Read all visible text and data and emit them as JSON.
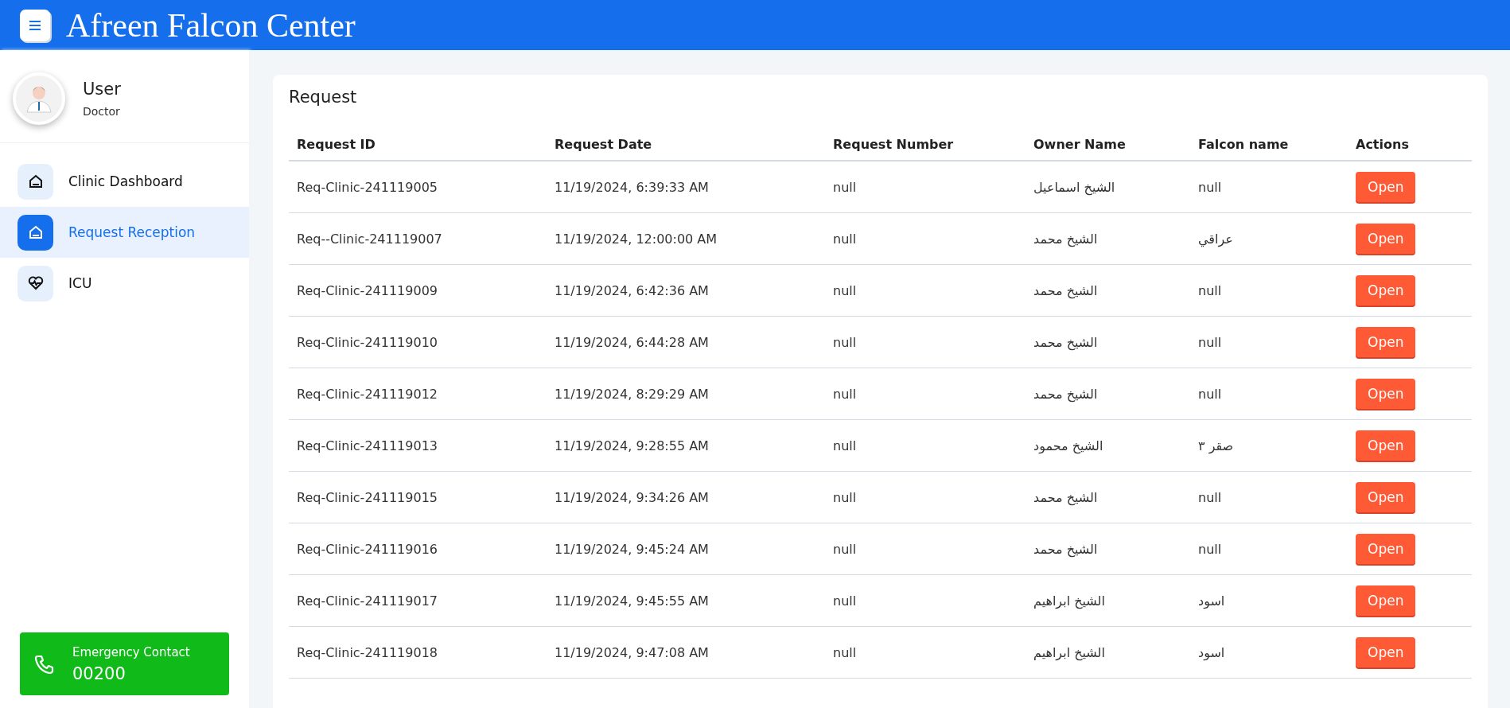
{
  "header": {
    "title": "Afreen Falcon Center"
  },
  "profile": {
    "name": "User",
    "role": "Doctor"
  },
  "sidebar": {
    "items": [
      {
        "label": "Clinic Dashboard",
        "kind": "home",
        "selected": false
      },
      {
        "label": "Request Reception",
        "kind": "home",
        "selected": true
      },
      {
        "label": "ICU",
        "kind": "heart",
        "selected": false
      }
    ]
  },
  "emergency": {
    "label": "Emergency Contact",
    "number": "00200"
  },
  "card": {
    "title": "Request"
  },
  "table": {
    "columns": [
      "Request ID",
      "Request Date",
      "Request Number",
      "Owner Name",
      "Falcon name",
      "Actions"
    ],
    "rows": [
      {
        "id": "Req-Clinic-241119005",
        "date": "11/19/2024, 6:39:33 AM",
        "number": "null",
        "owner": "الشيخ اسماعيل",
        "falcon": "null",
        "action": "Open"
      },
      {
        "id": "Req--Clinic-241119007",
        "date": "11/19/2024, 12:00:00 AM",
        "number": "null",
        "owner": "الشيخ محمد",
        "falcon": "عراقي",
        "action": "Open"
      },
      {
        "id": "Req-Clinic-241119009",
        "date": "11/19/2024, 6:42:36 AM",
        "number": "null",
        "owner": "الشيخ محمد",
        "falcon": "null",
        "action": "Open"
      },
      {
        "id": "Req-Clinic-241119010",
        "date": "11/19/2024, 6:44:28 AM",
        "number": "null",
        "owner": "الشيخ محمد",
        "falcon": "null",
        "action": "Open"
      },
      {
        "id": "Req-Clinic-241119012",
        "date": "11/19/2024, 8:29:29 AM",
        "number": "null",
        "owner": "الشيخ محمد",
        "falcon": "null",
        "action": "Open"
      },
      {
        "id": "Req-Clinic-241119013",
        "date": "11/19/2024, 9:28:55 AM",
        "number": "null",
        "owner": "الشيخ محمود",
        "falcon": "صقر ٣",
        "action": "Open"
      },
      {
        "id": "Req-Clinic-241119015",
        "date": "11/19/2024, 9:34:26 AM",
        "number": "null",
        "owner": "الشيخ محمد",
        "falcon": "null",
        "action": "Open"
      },
      {
        "id": "Req-Clinic-241119016",
        "date": "11/19/2024, 9:45:24 AM",
        "number": "null",
        "owner": "الشيخ محمد",
        "falcon": "null",
        "action": "Open"
      },
      {
        "id": "Req-Clinic-241119017",
        "date": "11/19/2024, 9:45:55 AM",
        "number": "null",
        "owner": "الشيخ ابراهيم",
        "falcon": "اسود",
        "action": "Open"
      },
      {
        "id": "Req-Clinic-241119018",
        "date": "11/19/2024, 9:47:08 AM",
        "number": "null",
        "owner": "الشيخ ابراهيم",
        "falcon": "اسود",
        "action": "Open"
      }
    ]
  }
}
